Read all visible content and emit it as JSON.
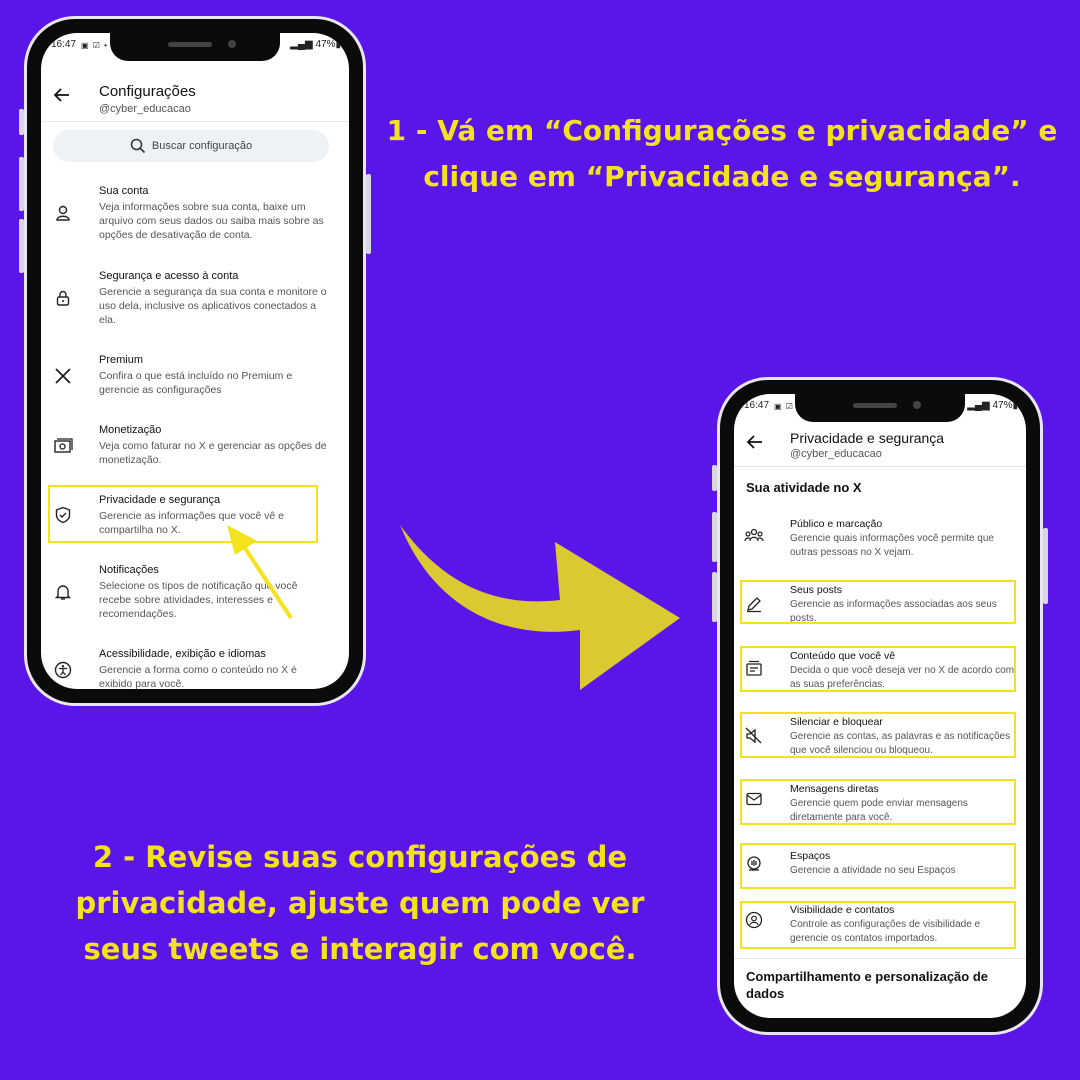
{
  "captions": {
    "step1": "1 - Vá em “Configurações e privacidade” e clique em “Privacidade e segurança”.",
    "step2": "2 - Revise suas configurações de privacidade, ajuste quem pode ver seus tweets e interagir com você."
  },
  "colors": {
    "background": "#5a16e8",
    "accent": "#f3e21c",
    "arrow": "#dcc831"
  },
  "phone1": {
    "status": {
      "time": "16:47",
      "battery": "47%"
    },
    "back_icon": "arrow-left-icon",
    "title": "Configurações",
    "handle": "@cyber_educacao",
    "search_placeholder": "Buscar configuração",
    "items": [
      {
        "icon": "person-icon",
        "title": "Sua conta",
        "desc": "Veja informações sobre sua conta, baixe um arquivo com seus dados ou saiba mais sobre as opções de desativação de conta."
      },
      {
        "icon": "lock-icon",
        "title": "Segurança e acesso à conta",
        "desc": "Gerencie a segurança da sua conta e monitore o uso dela, inclusive os aplicativos conectados a ela."
      },
      {
        "icon": "x-logo-icon",
        "title": "Premium",
        "desc": "Confira o que está incluído no Premium e gerencie as configurações"
      },
      {
        "icon": "money-icon",
        "title": "Monetização",
        "desc": "Veja como faturar no X e gerenciar as opções de monetização."
      },
      {
        "icon": "shield-icon",
        "title": "Privacidade e segurança",
        "desc": "Gerencie as informações que você vê e compartilha no X."
      },
      {
        "icon": "bell-icon",
        "title": "Notificações",
        "desc": "Selecione os tipos de notificação que você recebe sobre atividades, interesses e recomendações."
      },
      {
        "icon": "accessibility-icon",
        "title": "Acessibilidade, exibição e idiomas",
        "desc": "Gerencie a forma como o conteúdo no X é exibido para você."
      }
    ]
  },
  "phone2": {
    "status": {
      "time": "16:47",
      "battery": "47%"
    },
    "back_icon": "arrow-left-icon",
    "title": "Privacidade e segurança",
    "handle": "@cyber_educacao",
    "section1": "Sua atividade no X",
    "items": [
      {
        "icon": "people-icon",
        "title": "Público e marcação",
        "desc": "Gerencie quais informações você permite que outras pessoas no X vejam."
      },
      {
        "icon": "pencil-icon",
        "title": "Seus posts",
        "desc": "Gerencie as informações associadas aos seus posts."
      },
      {
        "icon": "content-icon",
        "title": "Conteúdo que você vê",
        "desc": "Decida o que você deseja ver no X de acordo com as suas preferências."
      },
      {
        "icon": "mute-icon",
        "title": "Silenciar e bloquear",
        "desc": "Gerencie as contas, as palavras e as notificações que você silenciou ou bloqueou."
      },
      {
        "icon": "envelope-icon",
        "title": "Mensagens diretas",
        "desc": "Gerencie quem pode enviar mensagens diretamente para você."
      },
      {
        "icon": "spaces-icon",
        "title": "Espaços",
        "desc": "Gerencie a atividade no seu Espaços"
      },
      {
        "icon": "contacts-icon",
        "title": "Visibilidade e contatos",
        "desc": "Controle as configurações de visibilidade e gerencie os contatos importados."
      }
    ],
    "section2": "Compartilhamento e personalização de dados"
  }
}
